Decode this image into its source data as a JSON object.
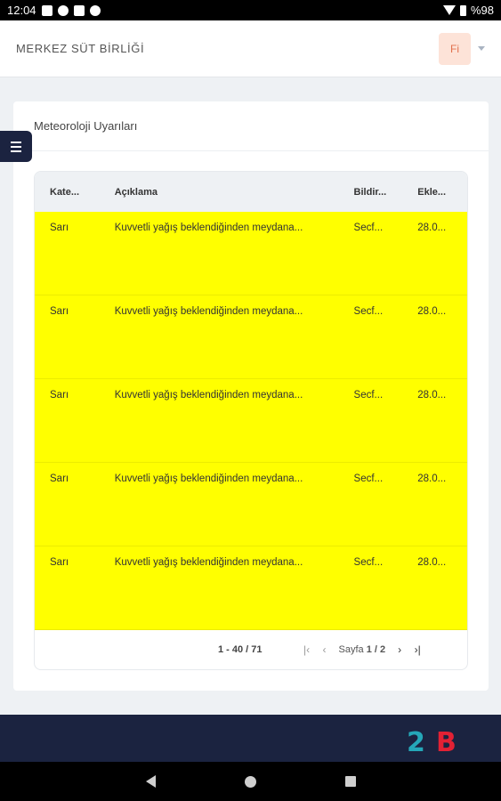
{
  "status_bar": {
    "time": "12:04",
    "battery": "%98"
  },
  "app": {
    "brand": "MERKEZ SÜT BİRLİĞİ",
    "user_initials": "Fi"
  },
  "card": {
    "title": "Meteoroloji Uyarıları"
  },
  "table": {
    "headers": [
      "Kate...",
      "Açıklama",
      "Bildir...",
      "Ekle..."
    ],
    "rows": [
      {
        "kategori": "Sarı",
        "aciklama": "Kuvvetli yağış beklendiğinden meydana...",
        "bildiren": "Secf...",
        "eklenme": "28.0..."
      },
      {
        "kategori": "Sarı",
        "aciklama": "Kuvvetli yağış beklendiğinden meydana...",
        "bildiren": "Secf...",
        "eklenme": "28.0..."
      },
      {
        "kategori": "Sarı",
        "aciklama": "Kuvvetli yağış beklendiğinden meydana...",
        "bildiren": "Secf...",
        "eklenme": "28.0..."
      },
      {
        "kategori": "Sarı",
        "aciklama": "Kuvvetli yağış beklendiğinden meydana...",
        "bildiren": "Secf...",
        "eklenme": "28.0..."
      },
      {
        "kategori": "Sarı",
        "aciklama": "Kuvvetli yağış beklendiğinden meydana...",
        "bildiren": "Secf...",
        "eklenme": "28.0..."
      }
    ],
    "row_color": "#ffff00"
  },
  "pagination": {
    "range": "1 - 40 / 71",
    "page_label": "Sayfa",
    "page_value": "1 / 2"
  },
  "footer": {
    "logo_left": "2",
    "logo_right": "B"
  },
  "colors": {
    "nav_dark": "#1b2340",
    "avatar_bg": "#fde3d8",
    "avatar_fg": "#e2704c"
  },
  "icons": [
    "wifi-icon",
    "battery-icon",
    "menu-icon",
    "first-page-icon",
    "prev-page-icon",
    "next-page-icon",
    "last-page-icon",
    "back-icon",
    "home-icon",
    "recents-icon"
  ]
}
